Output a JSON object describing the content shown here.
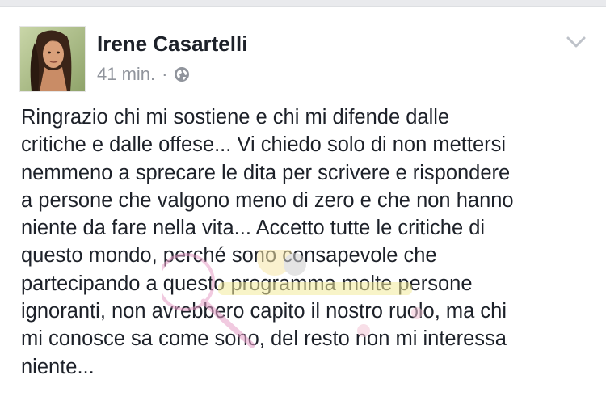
{
  "post": {
    "author": "Irene Casartelli",
    "time": "41 min.",
    "separator": "·",
    "privacy_icon": "globe-icon",
    "menu_icon": "chevron-down-icon",
    "text": "Ringrazio chi mi sostiene e chi mi difende dalle\ncritiche e dalle offese... Vi chiedo solo di non mettersi\nnemmeno a sprecare le dita per scrivere e rispondere\na persone che valgono meno di zero e che non hanno\nniente da fare nella vita... Accetto tutte le critiche di\nquesto mondo, perché sono consapevole che\npartecipando a questo programma molte persone\nignoranti, non avrebbero capito il nostro ruolo, ma chi\nmi conosce sa come sono, del resto non mi interessa\nniente..."
  },
  "colors": {
    "name": "#1d2129",
    "meta": "#90949c",
    "strip": "#e9eaed"
  }
}
